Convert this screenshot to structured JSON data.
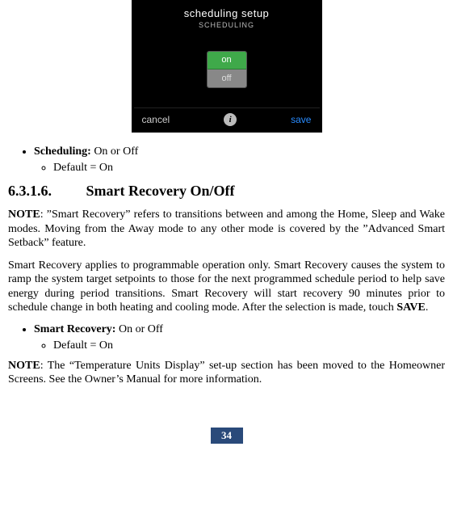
{
  "device": {
    "title": "scheduling setup",
    "subtitle": "SCHEDULING",
    "option_on": "on",
    "option_off": "off",
    "cancel": "cancel",
    "save": "save",
    "info_glyph": "i"
  },
  "bullet1": {
    "label": "Scheduling:",
    "value": "On or Off",
    "sub": "Default = On"
  },
  "heading": {
    "number": "6.3.1.6.",
    "title": "Smart Recovery On/Off"
  },
  "note1_label": "NOTE",
  "note1_text": ":  ”Smart Recovery” refers to transitions between and among the Home, Sleep and Wake modes. Moving from the Away mode to any other mode is covered by the ”Advanced Smart Setback” feature.",
  "para2a": "Smart Recovery applies to programmable operation only. Smart Recovery causes the system to ramp the system target setpoints to those for the next programmed schedule period to help save energy during period transitions. Smart Recovery will start recovery 90 minutes prior to schedule change in both heating and cooling mode. After the selection is made, touch ",
  "para2_save": "SAVE",
  "para2b": ".",
  "bullet2": {
    "label": "Smart Recovery:",
    "value": "On or Off",
    "sub": "Default = On"
  },
  "note2_label": "NOTE",
  "note2_text": ":  The “Temperature Units Display” set-up section has been moved to the Homeowner Screens. See the Owner’s Manual for more information.",
  "page_number": "34"
}
